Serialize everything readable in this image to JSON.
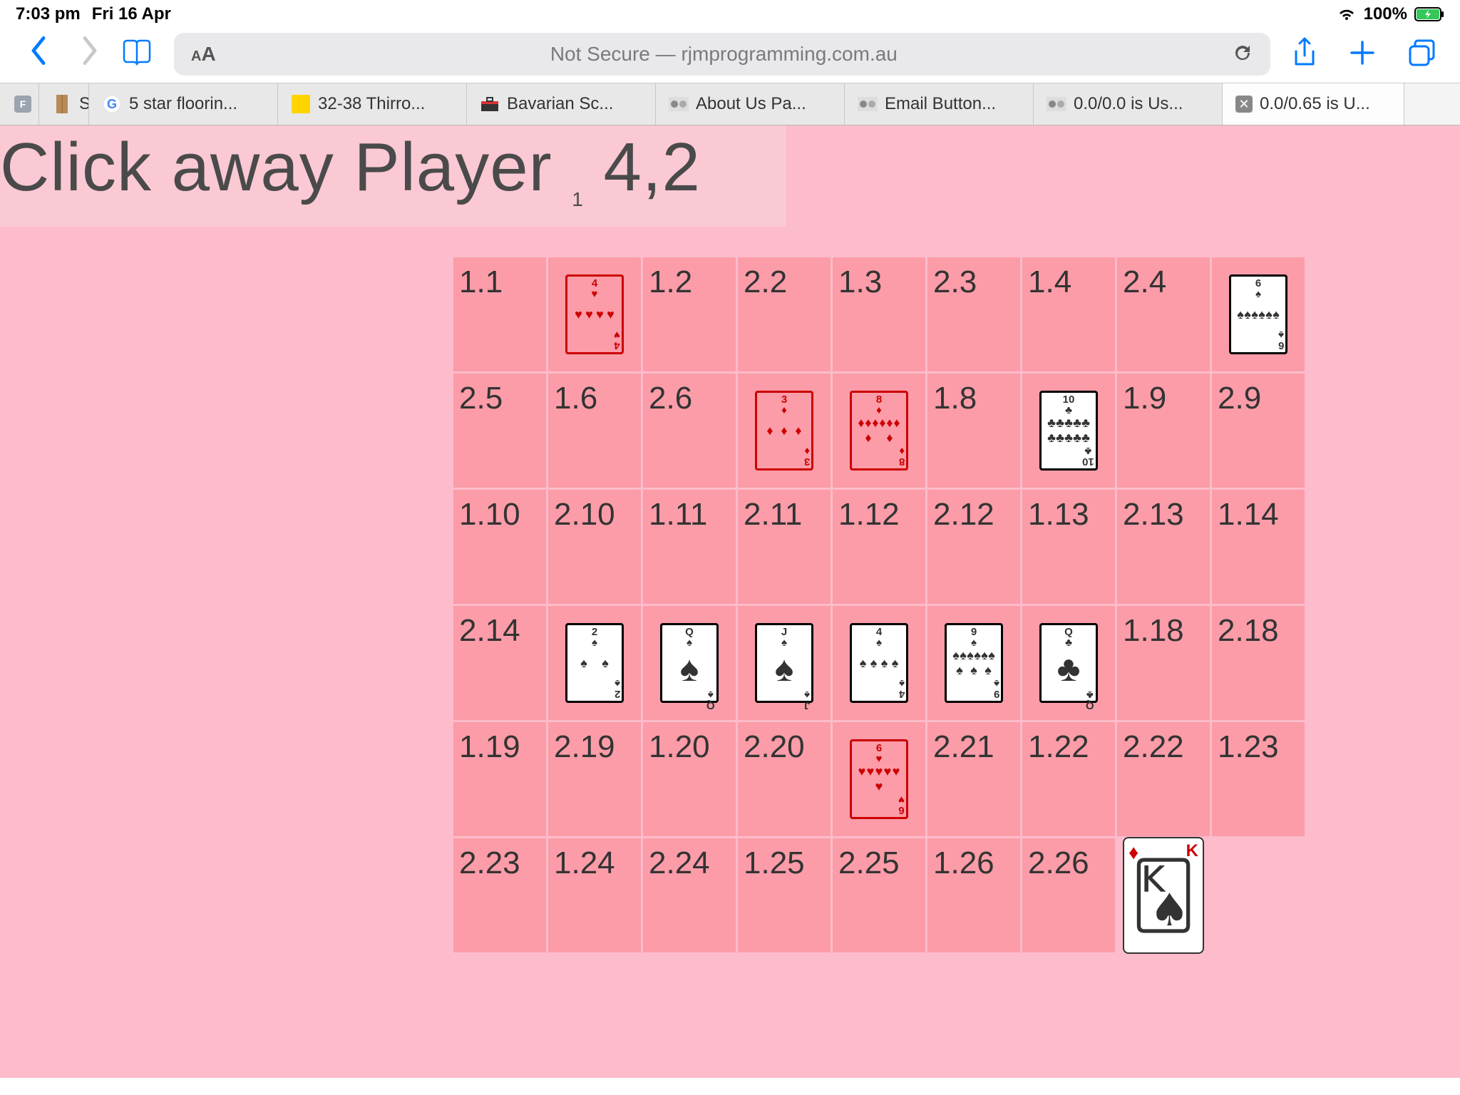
{
  "status": {
    "time": "7:03 pm",
    "date": "Fri 16 Apr",
    "battery": "100%"
  },
  "toolbar": {
    "aa_small": "A",
    "aa_big": "A",
    "url_prefix": "Not Secure — ",
    "url_host": "rjmprogramming.com.au"
  },
  "tabs": [
    {
      "label": "",
      "icon": "gray"
    },
    {
      "label": "Syd",
      "icon": "door"
    },
    {
      "label": "5 star floorin...",
      "icon": "g"
    },
    {
      "label": "32-38 Thirro...",
      "icon": "yellow"
    },
    {
      "label": "Bavarian Sc...",
      "icon": "bag"
    },
    {
      "label": "About Us Pa...",
      "icon": "blur"
    },
    {
      "label": "Email Button...",
      "icon": "blur"
    },
    {
      "label": "0.0/0.0 is Us...",
      "icon": "blur"
    },
    {
      "label": "0.0/0.65 is U...",
      "icon": "close",
      "active": true
    }
  ],
  "game": {
    "title_main": "Click away Player ",
    "title_sub": "1",
    "title_tail": " 4,2",
    "grid": [
      [
        {
          "t": "1.1"
        },
        {
          "c": {
            "rank": "4",
            "suit": "♥",
            "red": true
          }
        },
        {
          "t": "1.2"
        },
        {
          "t": "2.2"
        },
        {
          "t": "1.3"
        },
        {
          "t": "2.3"
        },
        {
          "t": "1.4"
        },
        {
          "t": "2.4"
        },
        {
          "c": {
            "rank": "6",
            "suit": "♠",
            "white": true
          }
        }
      ],
      [
        {
          "t": "2.5"
        },
        {
          "t": "1.6"
        },
        {
          "t": "2.6"
        },
        {
          "c": {
            "rank": "3",
            "suit": "♦",
            "red": true
          }
        },
        {
          "c": {
            "rank": "8",
            "suit": "♦",
            "red": true
          }
        },
        {
          "t": "1.8"
        },
        {
          "c": {
            "rank": "10",
            "suit": "♣",
            "white": true
          }
        },
        {
          "t": "1.9"
        },
        {
          "t": "2.9"
        }
      ],
      [
        {
          "t": "1.10"
        },
        {
          "t": "2.10"
        },
        {
          "t": "1.11"
        },
        {
          "t": "2.11"
        },
        {
          "t": "1.12"
        },
        {
          "t": "2.12"
        },
        {
          "t": "1.13"
        },
        {
          "t": "2.13"
        },
        {
          "t": "1.14"
        }
      ],
      [
        {
          "t": "2.14"
        },
        {
          "c": {
            "rank": "2",
            "suit": "♠",
            "white": true
          }
        },
        {
          "c": {
            "rank": "Q",
            "suit": "♠",
            "white": true,
            "face": true
          }
        },
        {
          "c": {
            "rank": "J",
            "suit": "♠",
            "white": true,
            "face": true
          }
        },
        {
          "c": {
            "rank": "4",
            "suit": "♠",
            "white": true
          }
        },
        {
          "c": {
            "rank": "9",
            "suit": "♠",
            "white": true
          }
        },
        {
          "c": {
            "rank": "Q",
            "suit": "♣",
            "white": true,
            "face": true
          }
        },
        {
          "t": "1.18"
        },
        {
          "t": "2.18"
        }
      ],
      [
        {
          "t": "1.19"
        },
        {
          "t": "2.19"
        },
        {
          "t": "1.20"
        },
        {
          "t": "2.20"
        },
        {
          "c": {
            "rank": "6",
            "suit": "♥",
            "red": true
          }
        },
        {
          "t": "2.21"
        },
        {
          "t": "1.22"
        },
        {
          "t": "2.22"
        },
        {
          "t": "1.23"
        }
      ],
      [
        {
          "t": "2.23"
        },
        {
          "t": "1.24"
        },
        {
          "t": "2.24"
        },
        {
          "t": "1.25"
        },
        {
          "t": "2.25"
        },
        {
          "t": "1.26"
        },
        {
          "t": "2.26"
        },
        {
          "king": {
            "rank": "K",
            "suit": "♦"
          }
        },
        null
      ]
    ]
  }
}
